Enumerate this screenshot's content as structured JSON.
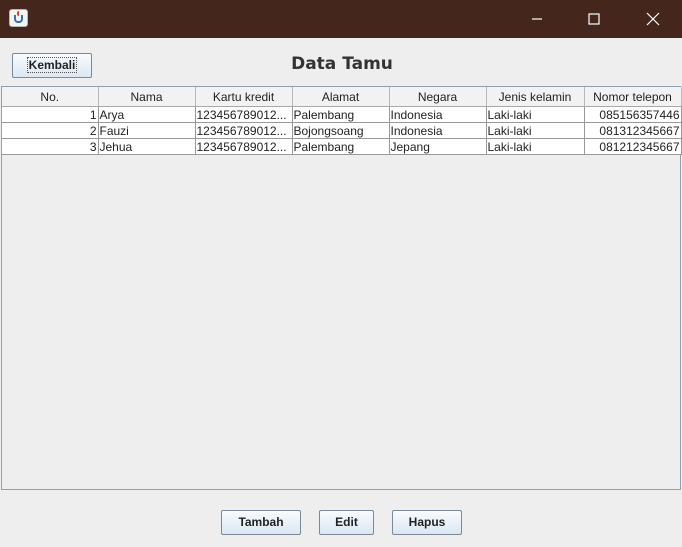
{
  "window": {
    "icon": "java-cup-icon"
  },
  "header": {
    "back_label": "Kembali",
    "title": "Data Tamu"
  },
  "table": {
    "columns": [
      "No.",
      "Nama",
      "Kartu kredit",
      "Alamat",
      "Negara",
      "Jenis kelamin",
      "Nomor telepon"
    ],
    "rows": [
      [
        "1",
        "Arya",
        "123456789012...",
        "Palembang",
        "Indonesia",
        "Laki-laki",
        "085156357446"
      ],
      [
        "2",
        "Fauzi",
        "123456789012...",
        "Bojongsoang",
        "Indonesia",
        "Laki-laki",
        "081312345667"
      ],
      [
        "3",
        "Jehua",
        "123456789012...",
        "Palembang",
        "Jepang",
        "Laki-laki",
        "081212345667"
      ]
    ]
  },
  "footer": {
    "add_label": "Tambah",
    "edit_label": "Edit",
    "delete_label": "Hapus"
  }
}
